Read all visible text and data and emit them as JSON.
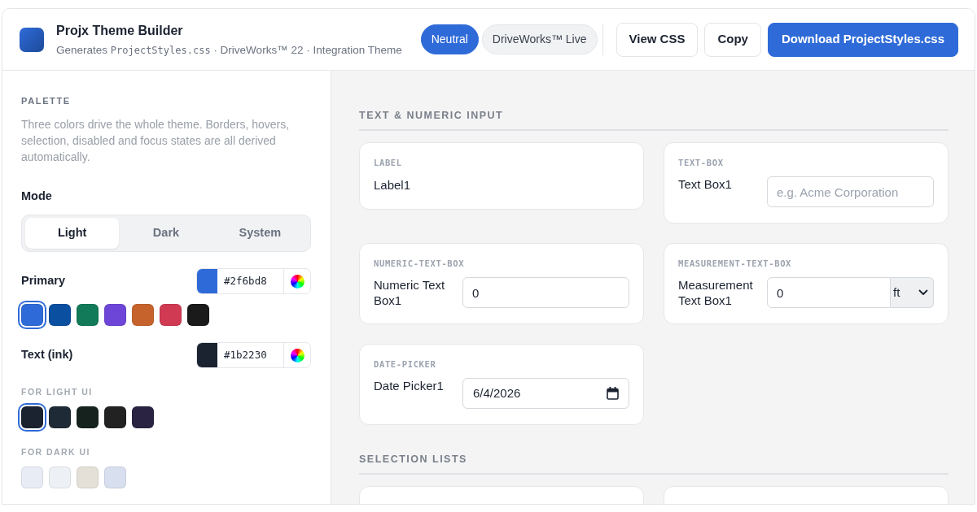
{
  "header": {
    "title": "Projx Theme Builder",
    "subtitle": {
      "lead": "Generates",
      "file": "ProjectStyles.css",
      "rest": "· DriveWorks™ 22 · Integration Theme"
    },
    "pills": [
      {
        "label": "Neutral",
        "selected": true
      },
      {
        "label": "DriveWorks™ Live",
        "selected": false
      }
    ],
    "buttons": [
      {
        "label": "View CSS",
        "kind": "outline"
      },
      {
        "label": "Copy",
        "kind": "outline"
      },
      {
        "label": "Download ProjectStyles.css",
        "kind": "primary"
      }
    ]
  },
  "sidebar": {
    "title": "PALETTE",
    "description": "Three colors drive the whole theme. Borders, hovers, selection, disabled and focus states are all derived automatically.",
    "mode": {
      "label": "Mode",
      "options": [
        {
          "label": "Light",
          "selected": true
        },
        {
          "label": "Dark",
          "selected": false
        },
        {
          "label": "System",
          "selected": false
        }
      ]
    },
    "colors": [
      {
        "label": "Primary",
        "hex": "#2f6bd8",
        "color": "#2f6bd8",
        "groups": [
          {
            "presets": [
              {
                "color": "#2f6bd8",
                "selected": true
              },
              {
                "color": "#0b4fa0",
                "selected": false
              },
              {
                "color": "#127a58",
                "selected": false
              },
              {
                "color": "#6d46d8",
                "selected": false
              },
              {
                "color": "#c6632c",
                "selected": false
              },
              {
                "color": "#d03a52",
                "selected": false
              },
              {
                "color": "#1a1a1a",
                "selected": false
              }
            ]
          }
        ]
      },
      {
        "label": "Text (ink)",
        "hex": "#1b2230",
        "color": "#1b2230",
        "groups": [
          {
            "title": "FOR LIGHT UI",
            "presets": [
              {
                "color": "#1b2230",
                "selected": true
              },
              {
                "color": "#1e2a35",
                "selected": false
              },
              {
                "color": "#15221d",
                "selected": false
              },
              {
                "color": "#222222",
                "selected": false
              },
              {
                "color": "#2a2341",
                "selected": false
              }
            ]
          },
          {
            "title": "FOR DARK UI",
            "presets": [
              {
                "color": "#e8ecf4",
                "selected": false
              },
              {
                "color": "#edf0f4",
                "selected": false
              },
              {
                "color": "#e5e0d7",
                "selected": false
              },
              {
                "color": "#d8dfef",
                "selected": false
              }
            ]
          }
        ]
      }
    ]
  },
  "main": {
    "sections": [
      {
        "title": "TEXT & NUMERIC INPUT",
        "controls": [
          {
            "kind": "label",
            "type_name": "LABEL",
            "text": "Label1"
          },
          {
            "kind": "text",
            "type_name": "TEXT-BOX",
            "label": "Text Box1",
            "placeholder": "e.g. Acme Corporation"
          },
          {
            "kind": "numeric",
            "type_name": "NUMERIC-TEXT-BOX",
            "label": "Numeric Text Box1",
            "value": "0"
          },
          {
            "kind": "measurement",
            "type_name": "MEASUREMENT-TEXT-BOX",
            "label": "Measurement Text Box1",
            "value": "0",
            "unit": "ft"
          },
          {
            "kind": "date",
            "type_name": "DATE-PICKER",
            "label": "Date Picker1",
            "value": "6/4/2026"
          }
        ]
      },
      {
        "title": "SELECTION LISTS",
        "controls": [
          {
            "kind": "cut_off"
          },
          {
            "kind": "cut_off"
          }
        ]
      }
    ]
  }
}
